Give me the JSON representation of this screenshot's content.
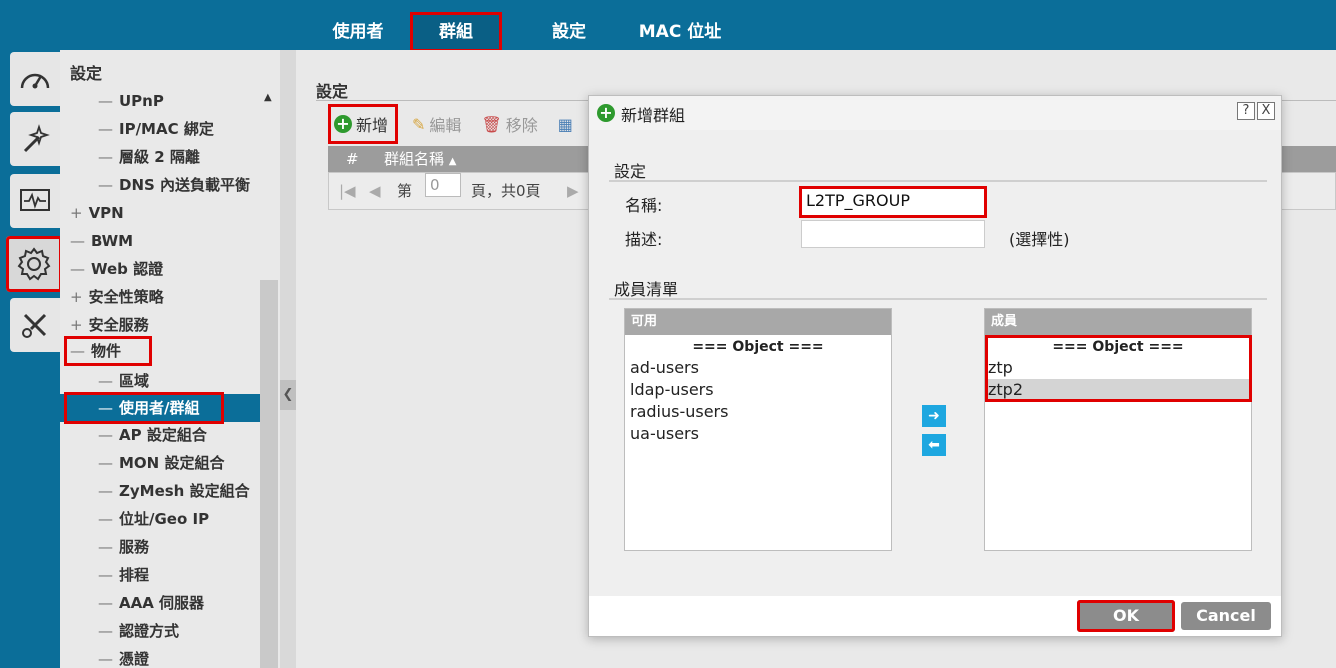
{
  "top_tabs": [
    "使用者",
    "群組",
    "設定",
    "MAC 位址"
  ],
  "rail_icons": [
    "dashboard-icon",
    "wand-icon",
    "monitor-icon",
    "gear-icon",
    "tools-icon"
  ],
  "sidebar": {
    "title": "設定",
    "items": [
      {
        "prefix": "—",
        "label": "UPnP"
      },
      {
        "prefix": "—",
        "label": "IP/MAC 綁定"
      },
      {
        "prefix": "—",
        "label": "層級 2 隔離"
      },
      {
        "prefix": "—",
        "label": "DNS 內送負載平衡"
      },
      {
        "prefix": "+",
        "label": "VPN"
      },
      {
        "prefix": "—",
        "label": "BWM"
      },
      {
        "prefix": "—",
        "label": "Web 認證"
      },
      {
        "prefix": "+",
        "label": "安全性策略"
      },
      {
        "prefix": "+",
        "label": "安全服務"
      },
      {
        "prefix": "—",
        "label": "物件"
      },
      {
        "prefix": "—",
        "label": "區域"
      },
      {
        "prefix": "—",
        "label": "使用者/群組"
      },
      {
        "prefix": "—",
        "label": "AP 設定組合"
      },
      {
        "prefix": "—",
        "label": "MON 設定組合"
      },
      {
        "prefix": "—",
        "label": "ZyMesh 設定組合"
      },
      {
        "prefix": "—",
        "label": "位址/Geo IP"
      },
      {
        "prefix": "—",
        "label": "服務"
      },
      {
        "prefix": "—",
        "label": "排程"
      },
      {
        "prefix": "—",
        "label": "AAA 伺服器"
      },
      {
        "prefix": "—",
        "label": "認證方式"
      },
      {
        "prefix": "—",
        "label": "憑證"
      }
    ]
  },
  "main": {
    "title": "設定",
    "toolbar": {
      "add": "新增",
      "edit": "編輯",
      "remove": "移除"
    },
    "grid": {
      "col_num": "#",
      "col_name": "群組名稱"
    },
    "pager": {
      "page_label": "第",
      "page_value": "0",
      "total_label": "頁，共0頁"
    }
  },
  "dialog": {
    "title": "新增群組",
    "help": "?",
    "close": "X",
    "settings_section": "設定",
    "name_label": "名稱:",
    "name_value": "L2TP_GROUP",
    "desc_label": "描述:",
    "desc_value": "",
    "desc_hint": "(選擇性)",
    "members_section": "成員清單",
    "available": {
      "header": "可用",
      "group": "=== Object ===",
      "items": [
        "ad-users",
        "ldap-users",
        "radius-users",
        "ua-users"
      ]
    },
    "members": {
      "header": "成員",
      "group": "=== Object ===",
      "items": [
        "ztp",
        "ztp2"
      ]
    },
    "ok": "OK",
    "cancel": "Cancel"
  },
  "colors": {
    "header_blue": "#0b6e99",
    "highlight_red": "#e00000",
    "arrow_blue": "#1ea7e0",
    "add_green": "#2e9a2e"
  }
}
